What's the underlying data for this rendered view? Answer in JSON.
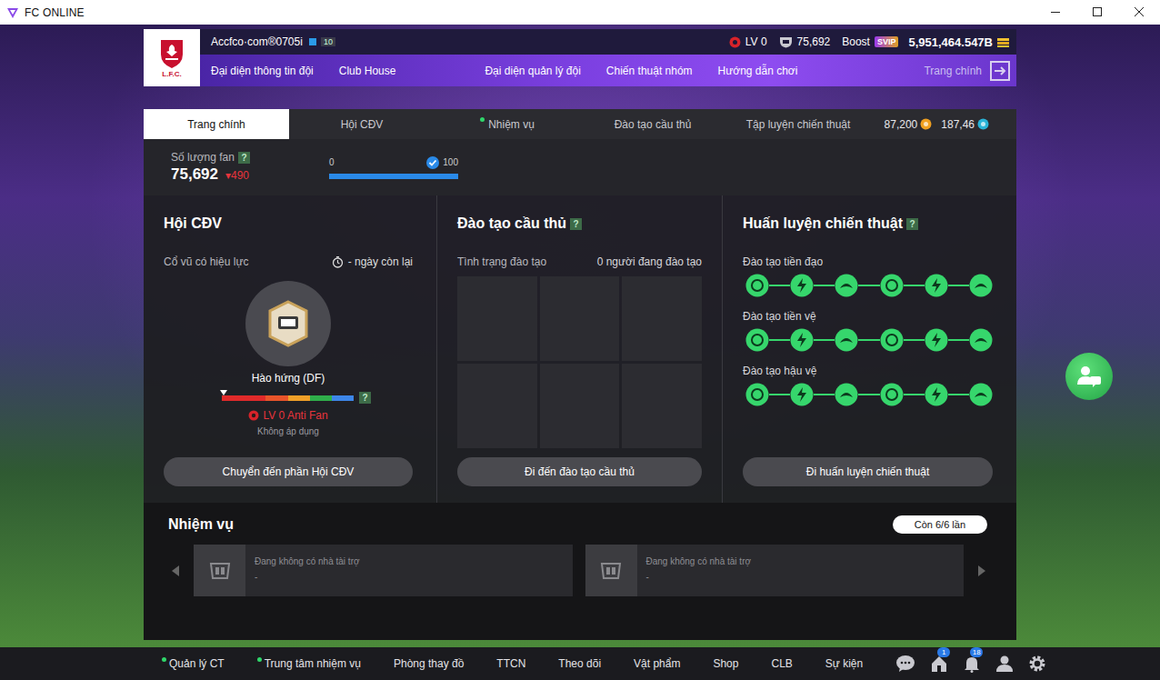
{
  "window": {
    "title": "FC ONLINE"
  },
  "help_glyph": "?",
  "header": {
    "club_logo": "L.F.C.",
    "name": "Accfco·com®0705i",
    "name_badge": "10",
    "level": "LV 0",
    "fans": "75,692",
    "boost": "Boost",
    "boost_badge": "SVIP",
    "balance": "5,951,464.547B"
  },
  "nav": {
    "items": [
      "Đại diện thông tin đội",
      "Club House",
      "Đại diện quản lý đội",
      "Chiến thuật nhóm",
      "Hướng dẫn chơi"
    ],
    "exit": "Trang chính"
  },
  "tabs": [
    {
      "label": "Trang chính",
      "selected": true,
      "dot": false
    },
    {
      "label": "Hội CĐV",
      "selected": false,
      "dot": false
    },
    {
      "label": "Nhiệm vụ",
      "selected": false,
      "dot": true
    },
    {
      "label": "Đào tạo cầu thủ",
      "selected": false,
      "dot": false
    },
    {
      "label": "Tập luyện chiến thuật",
      "selected": false,
      "dot": false
    }
  ],
  "currencies": [
    {
      "value": "87,200",
      "color": "#f0a020"
    },
    {
      "value": "187,46",
      "color": "#2ab4d8"
    }
  ],
  "fan_count": {
    "label": "Số lượng fan",
    "value": "75,692",
    "change": "▾490",
    "progress": {
      "min": "0",
      "max": "100",
      "level": 1,
      "done": true
    }
  },
  "supporters": {
    "title": "Hội CĐV",
    "effect_label": "Cổ vũ có hiệu lực",
    "days_left": "- ngày còn lại",
    "mood": "Hào hứng (DF)",
    "mood_level": 0,
    "segments": [
      {
        "color": "#e02a2a"
      },
      {
        "color": "#e8542a"
      },
      {
        "color": "#f0a028"
      },
      {
        "color": "#2fae4a"
      },
      {
        "color": "#3d86e8"
      }
    ],
    "fan_level": "LV 0 Anti Fan",
    "status": "Không áp dụng",
    "button": "Chuyển đến phần Hội CĐV"
  },
  "training": {
    "title": "Đào tạo cầu thủ",
    "status_label": "Tình trạng đào tạo",
    "count": "0 người đang đào tạo",
    "slots": [
      {
        "filled": false
      },
      {
        "filled": false
      },
      {
        "filled": false
      },
      {
        "filled": false
      },
      {
        "filled": false
      },
      {
        "filled": false
      }
    ],
    "button": "Đi đến đào tạo cầu thủ"
  },
  "tactics": {
    "title": "Huấn luyện chiến thuật",
    "groups": [
      {
        "label": "Đào tạo tiền đạo",
        "nodes": [
          {
            "unlocked": true
          },
          {
            "unlocked": true
          },
          {
            "unlocked": true
          },
          {
            "unlocked": true
          },
          {
            "unlocked": true
          },
          {
            "unlocked": true
          }
        ]
      },
      {
        "label": "Đào tạo tiền vệ",
        "nodes": [
          {
            "unlocked": true
          },
          {
            "unlocked": true
          },
          {
            "unlocked": true
          },
          {
            "unlocked": true
          },
          {
            "unlocked": true
          },
          {
            "unlocked": true
          }
        ]
      },
      {
        "label": "Đào tạo hậu vệ",
        "nodes": [
          {
            "unlocked": true
          },
          {
            "unlocked": true
          },
          {
            "unlocked": true
          },
          {
            "unlocked": true
          },
          {
            "unlocked": true
          },
          {
            "unlocked": true
          }
        ]
      }
    ],
    "button": "Đi huấn luyện chiến thuật"
  },
  "missions": {
    "title": "Nhiệm vụ",
    "remaining": "Còn 6/6 lần",
    "cards": [
      {
        "title": "Đang không có nhà tài trợ",
        "detail": "-"
      },
      {
        "title": "Đang không có nhà tài trợ",
        "detail": "-"
      }
    ]
  },
  "bottom_bar": {
    "items": [
      {
        "label": "Quản lý CT",
        "dot": true
      },
      {
        "label": "Trung tâm nhiệm vụ",
        "dot": true
      },
      {
        "label": "Phòng thay đồ",
        "dot": false
      },
      {
        "label": "TTCN",
        "dot": false
      },
      {
        "label": "Theo dõi",
        "dot": false
      },
      {
        "label": "Vật phẩm",
        "dot": false
      },
      {
        "label": "Shop",
        "dot": false
      },
      {
        "label": "CLB",
        "dot": false
      },
      {
        "label": "Sự kiện",
        "dot": false
      }
    ],
    "icons": [
      {
        "kind": "chat",
        "badge": ""
      },
      {
        "kind": "home",
        "badge": "1"
      },
      {
        "kind": "bell",
        "badge": "18"
      },
      {
        "kind": "profile",
        "badge": ""
      },
      {
        "kind": "settings",
        "badge": ""
      }
    ]
  }
}
